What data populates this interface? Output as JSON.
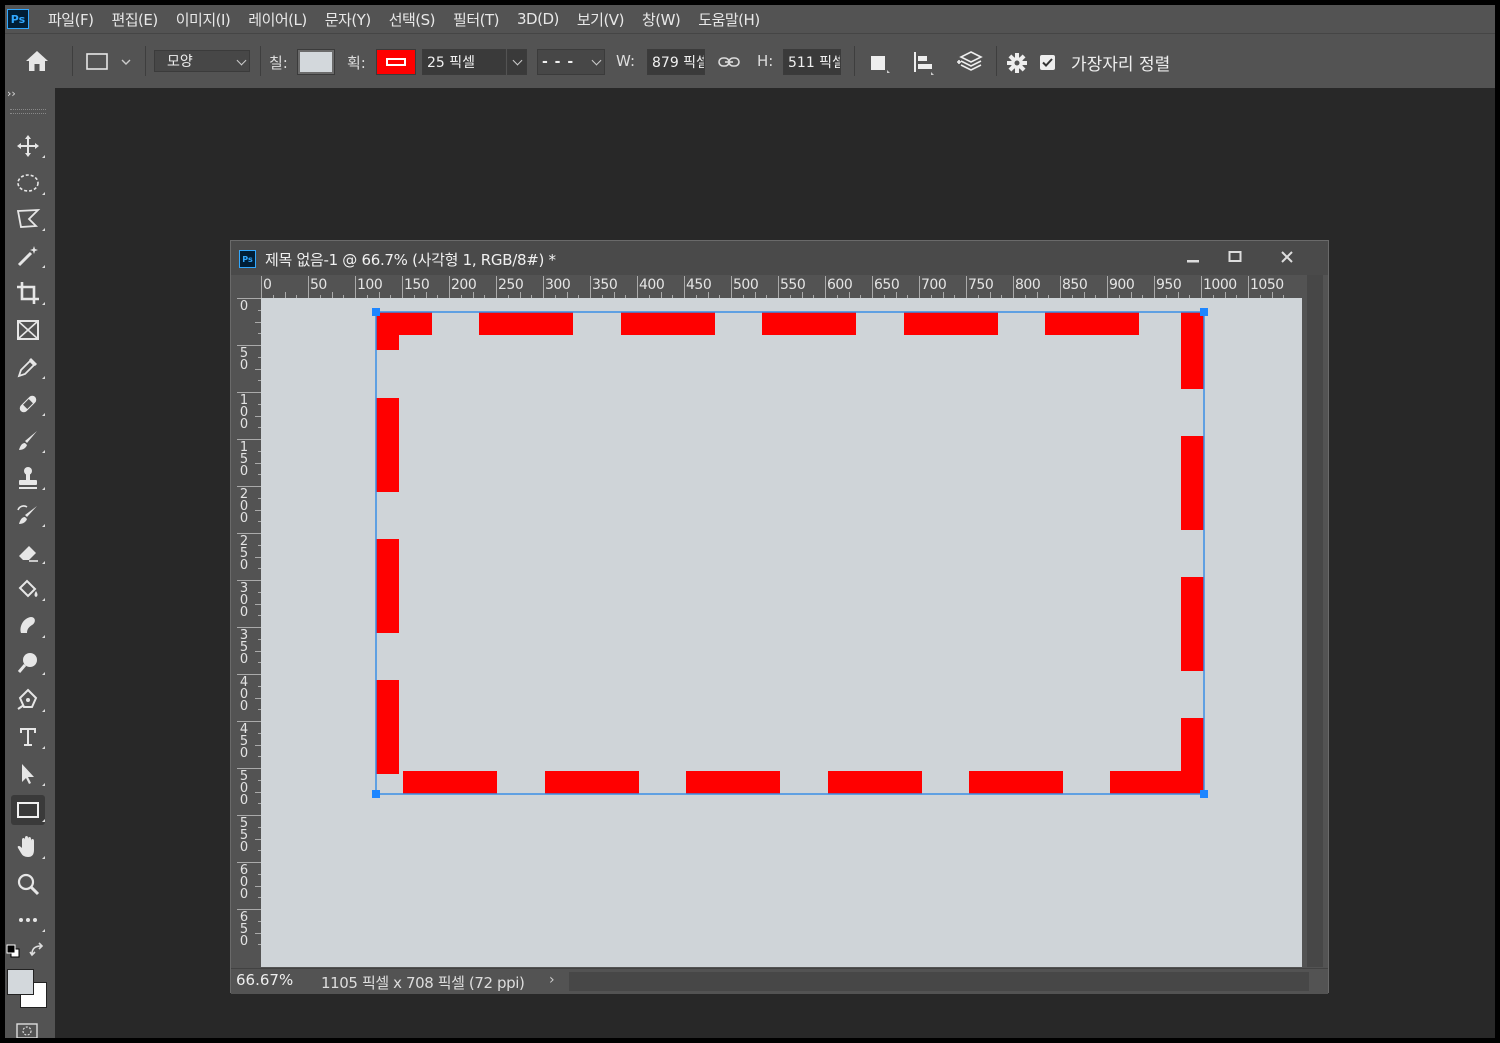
{
  "app": {
    "logo_text": "Ps"
  },
  "menu": {
    "items": [
      "파일(F)",
      "편집(E)",
      "이미지(I)",
      "레이어(L)",
      "문자(Y)",
      "선택(S)",
      "필터(T)",
      "3D(D)",
      "보기(V)",
      "창(W)",
      "도움말(H)"
    ]
  },
  "options": {
    "mode_value": "모양",
    "fill_label": "칠:",
    "stroke_label": "획:",
    "stroke_width": "25 픽셀",
    "stroke_type": "- - -",
    "w_label": "W:",
    "w_value": "879 픽셀",
    "h_label": "H:",
    "h_value": "511 픽셀",
    "align_edges_label": "가장자리 정렬",
    "align_edges_checked": true,
    "fill_color": "#d3d8dc",
    "stroke_color": "#ff0000"
  },
  "toolbar": {
    "tools": [
      "move-tool",
      "elliptical-marquee-tool",
      "polygonal-lasso-tool",
      "magic-wand-tool",
      "crop-tool",
      "frame-tool",
      "eyedropper-tool",
      "healing-brush-tool",
      "brush-tool",
      "clone-stamp-tool",
      "history-brush-tool",
      "eraser-tool",
      "paint-bucket-tool",
      "smudge-tool",
      "dodge-tool",
      "pen-tool",
      "type-tool",
      "path-selection-tool",
      "rectangle-tool",
      "hand-tool",
      "zoom-tool",
      "edit-toolbar"
    ],
    "active_tool": "rectangle-tool",
    "foreground_color": "#d3d8dc",
    "background_color": "#ffffff"
  },
  "document": {
    "title": "제목 없음-1 @ 66.7% (사각형 1, RGB/8#) *",
    "zoom": "66.67%",
    "info": "1105 픽셀 x 708 픽셀 (72 ppi)",
    "canvas_color": "#cfd4d8",
    "h_ruler": [
      "0",
      "50",
      "100",
      "150",
      "200",
      "250",
      "300",
      "350",
      "400",
      "450",
      "500",
      "550",
      "600",
      "650",
      "700",
      "750",
      "800",
      "850",
      "900",
      "950",
      "1000",
      "1050"
    ],
    "v_ruler": [
      "0",
      "50",
      "100",
      "150",
      "200",
      "250",
      "300",
      "350",
      "400",
      "450",
      "500",
      "550",
      "600",
      "650"
    ]
  }
}
